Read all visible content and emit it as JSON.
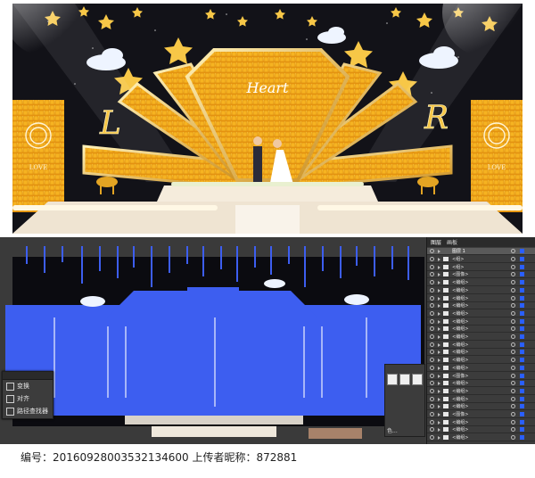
{
  "render": {
    "heart_script": "Heart",
    "left_letter": "L",
    "right_letter": "R",
    "panel_text": "LOVE"
  },
  "tools_panel": {
    "items": [
      {
        "label": "变换",
        "icon": "transform-icon"
      },
      {
        "label": "对齐",
        "icon": "align-icon"
      },
      {
        "label": "路径查找器",
        "icon": "pathfinder-icon"
      }
    ]
  },
  "layers_panel": {
    "tabs": [
      "图层",
      "画板"
    ],
    "top_layer": "图层 1",
    "rows": [
      "<组>",
      "<组>",
      "<图像>",
      "<编组>",
      "<编组>",
      "<编组>",
      "<编组>",
      "<编组>",
      "<编组>",
      "<编组>",
      "<编组>",
      "<编组>",
      "<编组>",
      "<编组>",
      "<编组>",
      "<图像>",
      "<编组>",
      "<编组>",
      "<编组>",
      "<编组>",
      "<图像>",
      "<编组>",
      "<编组>",
      "<编组>"
    ]
  },
  "mini_panel": {
    "label": "色..."
  },
  "footer": {
    "text": "编号：20160928003532134600 上传者昵称：872881"
  },
  "colors": {
    "gold": "#f2a91b",
    "stage_bg": "#121218",
    "selection_blue": "#3d5ef0",
    "canvas_bg": "#3a3a3a"
  }
}
